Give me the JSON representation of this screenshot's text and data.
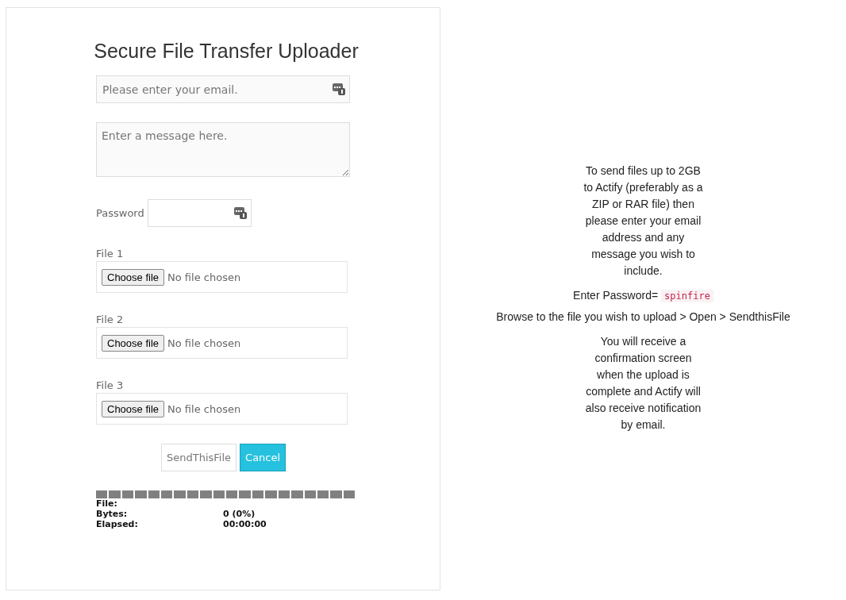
{
  "form": {
    "title": "Secure File Transfer Uploader",
    "email": {
      "placeholder": "Please enter your email."
    },
    "message": {
      "placeholder": "Enter a message here."
    },
    "password": {
      "label": "Password"
    },
    "files": [
      {
        "label": "File 1",
        "button": "Choose file",
        "status": "No file chosen"
      },
      {
        "label": "File 2",
        "button": "Choose file",
        "status": "No file chosen"
      },
      {
        "label": "File 3",
        "button": "Choose file",
        "status": "No file chosen"
      }
    ],
    "buttons": [
      {
        "label": "SendThisFile",
        "kind": "plain"
      },
      {
        "label": "Cancel",
        "kind": "primary"
      }
    ],
    "progress": {
      "level": 0,
      "rows": [
        {
          "label": "File:",
          "value": ""
        },
        {
          "label": "Bytes:",
          "value": "0 (0%)"
        },
        {
          "label": "Elapsed:",
          "value": "00:00:00"
        }
      ]
    }
  },
  "instructions": {
    "intro": "To send files up to 2GB to Actify (preferably as a ZIP or RAR file) then please enter your email address and any message you wish to include.",
    "password_label": "Enter Password=",
    "password_value": "spinfire",
    "browse": "Browse to the file you wish to upload > Open > SendthisFile",
    "outro": "You will receive a confirmation screen when the upload is complete and Actify will also receive notification by email."
  }
}
